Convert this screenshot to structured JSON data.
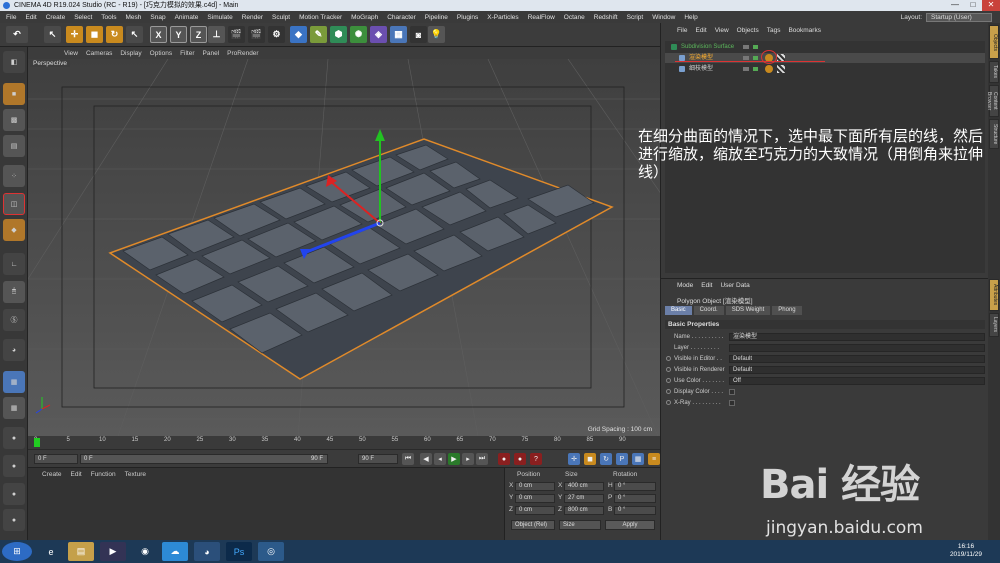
{
  "window": {
    "title": "CINEMA 4D R19.024 Studio (RC - R19) - [巧克力模拟的效果.c4d] - Main",
    "controls": [
      "—",
      "□",
      "✕"
    ]
  },
  "menubar": {
    "items": [
      "File",
      "Edit",
      "Create",
      "Select",
      "Tools",
      "Mesh",
      "Snap",
      "Animate",
      "Simulate",
      "Render",
      "Sculpt",
      "Motion Tracker",
      "MoGraph",
      "Character",
      "Pipeline",
      "Plugins",
      "X-Particles",
      "RealFlow",
      "Octane",
      "Redshift",
      "Script",
      "Window",
      "Help"
    ],
    "layout_label": "Layout:",
    "layout_value": "Startup (User)"
  },
  "toolbar": {
    "axis_buttons": [
      "X",
      "Y",
      "Z"
    ]
  },
  "viewport": {
    "menu": [
      "View",
      "Cameras",
      "Display",
      "Options",
      "Filter",
      "Panel",
      "ProRender"
    ],
    "camera_label": "Perspective",
    "grid_spacing": "Grid Spacing : 100 cm"
  },
  "timeline": {
    "ticks": [
      "0",
      "5",
      "10",
      "15",
      "20",
      "25",
      "30",
      "35",
      "40",
      "45",
      "50",
      "55",
      "60",
      "65",
      "70",
      "75",
      "80",
      "85",
      "90"
    ],
    "current_frame_marker": "0 F"
  },
  "transport": {
    "start_field": "0 F",
    "min_field": "0 F",
    "max_field": "90 F",
    "end_field": "90 F"
  },
  "material_panel": {
    "menu": [
      "Create",
      "Edit",
      "Function",
      "Texture"
    ]
  },
  "coordinates": {
    "headers": [
      "Position",
      "Size",
      "Rotation"
    ],
    "rows": [
      {
        "axis": "X",
        "pos": "0 cm",
        "size_axis": "X",
        "size": "400 cm",
        "rot_axis": "H",
        "rot": "0 °"
      },
      {
        "axis": "Y",
        "pos": "0 cm",
        "size_axis": "Y",
        "size": "27 cm",
        "rot_axis": "P",
        "rot": "0 °"
      },
      {
        "axis": "Z",
        "pos": "0 cm",
        "size_axis": "Z",
        "size": "800 cm",
        "rot_axis": "B",
        "rot": "0 °"
      }
    ],
    "mode_drop": "Object (Rel)",
    "size_drop": "Size",
    "apply": "Apply"
  },
  "object_manager": {
    "menu": [
      "File",
      "Edit",
      "View",
      "Objects",
      "Tags",
      "Bookmarks"
    ],
    "objects": [
      {
        "name": "Subdivision Surface",
        "selected": false
      },
      {
        "name": "渲染模型",
        "selected": true
      },
      {
        "name": "细枝模型",
        "selected": false
      }
    ]
  },
  "attributes": {
    "menu": [
      "Mode",
      "Edit",
      "User Data"
    ],
    "object_title": "Polygon Object [渲染模型]",
    "tabs": [
      "Basic",
      "Coord.",
      "SDS Weight",
      "Phong"
    ],
    "active_tab": "Basic",
    "section": "Basic Properties",
    "rows": [
      {
        "label": "Name . . . . . . . . . .",
        "value": "渲染模型"
      },
      {
        "label": "Layer . . . . . . . . .",
        "value": ""
      },
      {
        "label": "Visible in Editor . .",
        "value": "Default"
      },
      {
        "label": "Visible in Renderer",
        "value": "Default"
      },
      {
        "label": "Use Color . . . . . . .",
        "value": "Off"
      },
      {
        "label": "Display Color . . . .",
        "value": ""
      },
      {
        "label": "X-Ray . . . . . . . . .",
        "value": ""
      }
    ]
  },
  "right_strip": {
    "tabs": [
      "Objects",
      "Takes",
      "Content Browser",
      "Structure",
      "Attributes",
      "Layers"
    ]
  },
  "annotation": {
    "text": "在细分曲面的情况下，选中最下面所有层的线，然后进行缩放，缩放至巧克力的大致情况（用倒角来拉伸线）"
  },
  "taskbar": {
    "time": "16:16",
    "date": "2019/11/29"
  },
  "watermark": {
    "logo": "Bai 经验",
    "url": "jingyan.baidu.com"
  }
}
